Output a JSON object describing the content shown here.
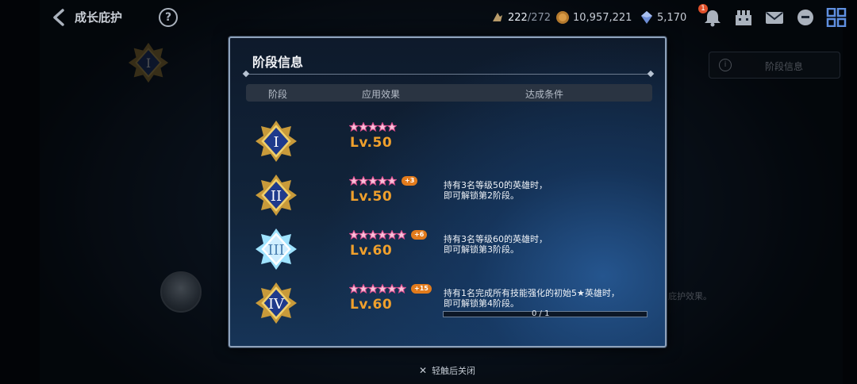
{
  "header": {
    "title": "成长庇护",
    "help_label": "?",
    "stamina": {
      "current": "222",
      "max": "/272"
    },
    "gold": "10,957,221",
    "gems": "5,170",
    "bell_badge": "1"
  },
  "background": {
    "tier_numeral": "I",
    "info_button_label": "阶段信息",
    "info_icon_label": "i",
    "note_text": "庇护效果。"
  },
  "modal": {
    "title": "阶段信息",
    "columns": {
      "stage": "阶段",
      "effect": "应用效果",
      "condition": "达成条件"
    },
    "rows": [
      {
        "numeral": "I",
        "stars": 5,
        "bonus": "",
        "level": "Lv.50",
        "condition_lines": [
          "",
          ""
        ]
      },
      {
        "numeral": "II",
        "stars": 5,
        "bonus": "+3",
        "level": "Lv.50",
        "condition_lines": [
          "持有3名等级50的英雄时，",
          "即可解锁第2阶段。"
        ]
      },
      {
        "numeral": "III",
        "stars": 6,
        "bonus": "+6",
        "level": "Lv.60",
        "condition_lines": [
          "持有3名等级60的英雄时，",
          "即可解锁第3阶段。"
        ]
      },
      {
        "numeral": "IV",
        "stars": 6,
        "bonus": "+15",
        "level": "Lv.60",
        "condition_lines": [
          "持有1名完成所有技能强化的初始5★英雄时，",
          "即可解锁第4阶段。"
        ]
      }
    ],
    "progress": {
      "label": "0 / 1",
      "value": 0,
      "max": 1
    }
  },
  "close_hint": {
    "icon": "close-icon",
    "label": "轻触后关闭"
  },
  "colors": {
    "accent_orange": "#f0a02c",
    "bonus_badge": "#e27b1c",
    "modal_border": "#8ea2bb"
  }
}
